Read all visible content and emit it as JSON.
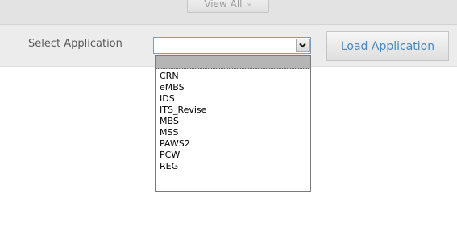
{
  "header": {
    "view_all_label": "View All",
    "view_all_arrow": "»"
  },
  "app_bar": {
    "select_label": "Select Application",
    "select_value": "",
    "load_button_label": "Load Application"
  },
  "dropdown": {
    "highlighted_option": "",
    "options": [
      "CRN",
      "eMBS",
      "IDS",
      "ITS_Revise",
      "MBS",
      "MSS",
      "PAWS2",
      "PCW",
      "REG"
    ]
  },
  "icons": {
    "dropdown_arrow": "chevron-down-icon"
  }
}
